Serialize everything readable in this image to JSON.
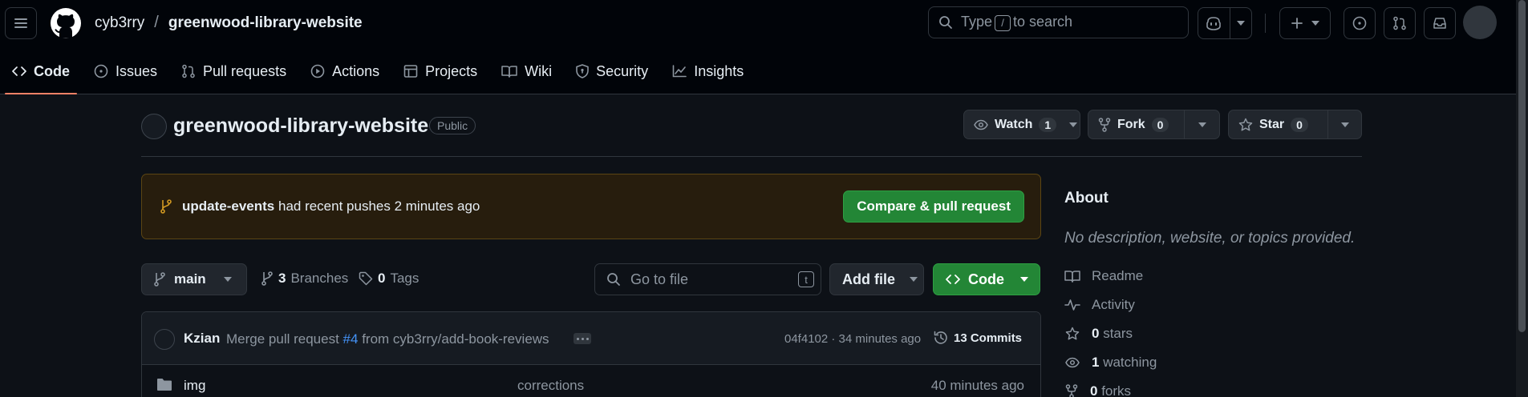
{
  "header": {
    "owner": "cyb3rry",
    "separator": "/",
    "repo": "greenwood-library-website",
    "search_prefix": "Type",
    "search_key": "/",
    "search_suffix": "to search"
  },
  "tabs": [
    {
      "label": "Code"
    },
    {
      "label": "Issues"
    },
    {
      "label": "Pull requests"
    },
    {
      "label": "Actions"
    },
    {
      "label": "Projects"
    },
    {
      "label": "Wiki"
    },
    {
      "label": "Security"
    },
    {
      "label": "Insights"
    }
  ],
  "repo": {
    "name": "greenwood-library-website",
    "visibility": "Public",
    "watch_label": "Watch",
    "watch_count": "1",
    "fork_label": "Fork",
    "fork_count": "0",
    "star_label": "Star",
    "star_count": "0"
  },
  "banner": {
    "branch": "update-events",
    "text": "had recent pushes 2 minutes ago",
    "button": "Compare & pull request"
  },
  "filenav": {
    "branch": "main",
    "branches_count": "3",
    "branches_label": "Branches",
    "tags_count": "0",
    "tags_label": "Tags",
    "goto_placeholder": "Go to file",
    "goto_key": "t",
    "add_file": "Add file",
    "code": "Code"
  },
  "commit": {
    "author": "Kzian",
    "msg_prefix": "Merge pull request",
    "pr": "#4",
    "msg_suffix": "from cyb3rry/add-book-reviews",
    "meta": "04f4102 · 34 minutes ago",
    "commits": "13 Commits"
  },
  "files": [
    {
      "name": "img",
      "commit": "corrections",
      "time": "40 minutes ago"
    }
  ],
  "about": {
    "title": "About",
    "description": "No description, website, or topics provided.",
    "readme": "Readme",
    "activity": "Activity",
    "stars_count": "0",
    "stars_label": "stars",
    "watching_count": "1",
    "watching_label": "watching",
    "forks_count": "0",
    "forks_label": "forks"
  },
  "colors": {
    "accent_green": "#238636",
    "tab_underline": "#f78166",
    "link_blue": "#4493f8",
    "banner_bg": "#271d0d"
  }
}
